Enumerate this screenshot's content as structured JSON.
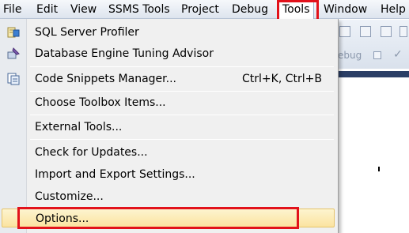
{
  "menubar": {
    "items": [
      "File",
      "Edit",
      "View",
      "SSMS Tools",
      "Project",
      "Debug",
      "Tools",
      "Window",
      "Help"
    ]
  },
  "background": {
    "toolbar_text": "ebug"
  },
  "tools_menu": {
    "items": [
      {
        "label": "SQL Server Profiler",
        "icon": "profiler-icon"
      },
      {
        "label": "Database Engine Tuning Advisor",
        "icon": "tuning-advisor-icon"
      },
      {
        "label": "Code Snippets Manager...",
        "shortcut": "Ctrl+K, Ctrl+B",
        "icon": "snippets-icon"
      },
      {
        "label": "Choose Toolbox Items..."
      },
      {
        "label": "External Tools..."
      },
      {
        "label": "Check for Updates..."
      },
      {
        "label": "Import and Export Settings..."
      },
      {
        "label": "Customize..."
      },
      {
        "label": "Options..."
      }
    ]
  },
  "colors": {
    "highlight_box": "#e2121b",
    "hover_fill": "#fbe3a0"
  }
}
